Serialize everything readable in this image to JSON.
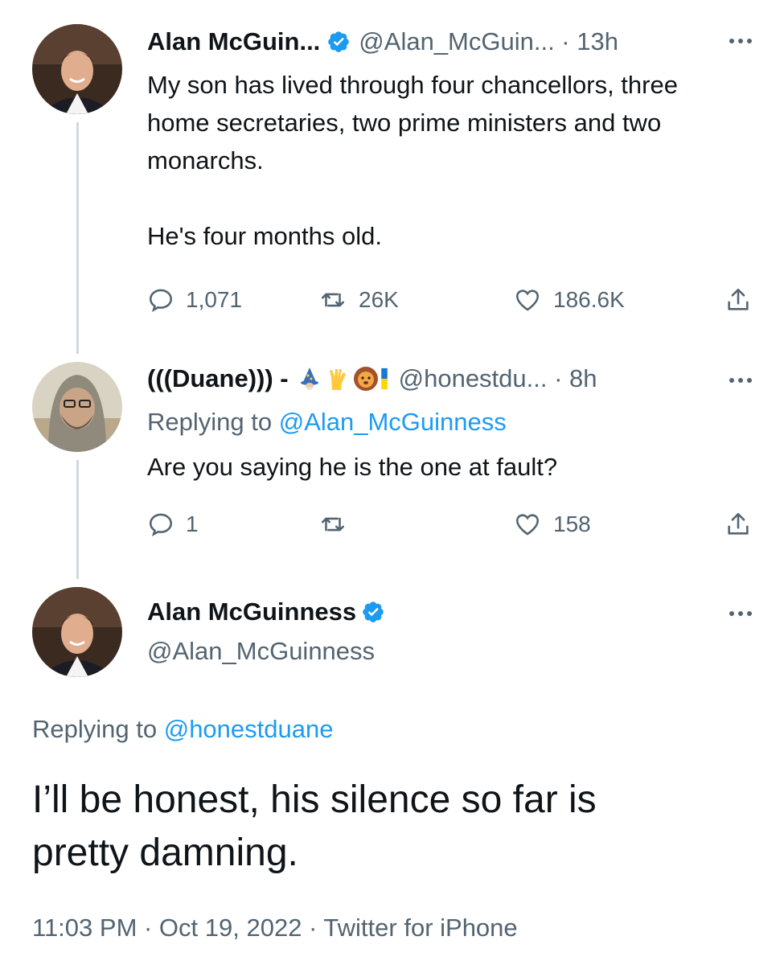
{
  "tweet1": {
    "author_name": "Alan McGuin...",
    "handle_time": "@Alan_McGuin... · 13h",
    "text": "My son has lived through four chancellors, three\nhome secretaries, two prime ministers and two\nmonarchs.\n\nHe's four months old.",
    "replies": "1,071",
    "retweets": "26K",
    "likes": "186.6K"
  },
  "tweet2": {
    "author_name": "(((Duane))) -",
    "handle_time": "@honestdu... · 8h",
    "replying_prefix": "Replying to ",
    "replying_to": "@Alan_McGuinness",
    "text": "Are you saying he is the one at fault?",
    "replies": "1",
    "retweets": "",
    "likes": "158"
  },
  "tweet3": {
    "author_name": "Alan McGuinness",
    "handle": "@Alan_McGuinness",
    "replying_prefix": "Replying to ",
    "replying_to": "@honestduane",
    "text": "I’ll be honest, his silence so far is\npretty damning.",
    "footer": "11:03 PM · Oct 19, 2022 · Twitter for iPhone"
  },
  "icons": {
    "verified": "verified-badge-icon",
    "reply": "reply-icon",
    "retweet": "retweet-icon",
    "like": "heart-icon",
    "share": "share-icon",
    "more": "more-options-icon",
    "emojis": [
      "wizard-emoji",
      "vulcan-salute-emoji",
      "lion-emoji",
      "ukraine-flag-emoji"
    ]
  },
  "colors": {
    "link": "#1d9bf0",
    "muted": "#536471",
    "text": "#0f1419",
    "thread_line": "#cfd9de"
  }
}
